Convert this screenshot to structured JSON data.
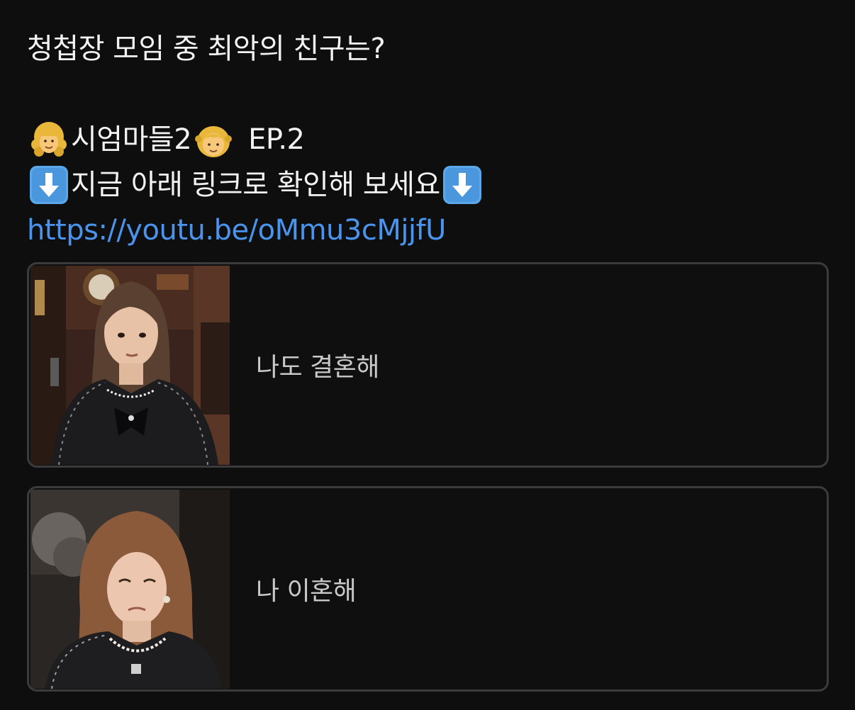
{
  "post": {
    "title": "청첩장 모임 중 최악의 친구는?",
    "line2_text": "시엄마들2",
    "line2_episode": "EP.2",
    "line2_emoji_left": "woman-curly-hair-emoji",
    "line2_emoji_right": "girl-emoji",
    "line3_text": "지금 아래 링크로 확인해 보세요",
    "line3_emoji": "down-arrow-emoji",
    "link": "https://youtu.be/oMmu3cMjjfU",
    "link_color": "#4a94ee"
  },
  "poll": {
    "options": [
      {
        "label": "나도 결혼해",
        "thumbnail": "woman-startled-thumbnail"
      },
      {
        "label": "나 이혼해",
        "thumbnail": "woman-wincing-thumbnail"
      }
    ]
  },
  "colors": {
    "background": "#0e0e0f",
    "option_border": "#3b3b3d",
    "option_text": "#c9c9cb"
  }
}
